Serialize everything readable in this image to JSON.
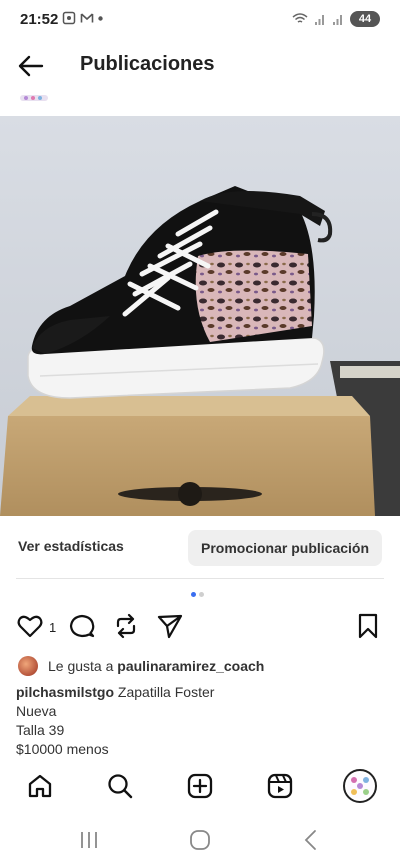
{
  "status_bar": {
    "time": "21:52",
    "battery": "44"
  },
  "header": {
    "title": "Publicaciones"
  },
  "post": {
    "stats_label": "Ver estadísticas",
    "promote_label": "Promocionar publicación",
    "like_count": "1",
    "liked_by_prefix": "Le gusta a",
    "liked_by_user": "paulinaramirez_coach",
    "username": "pilchasmilstgo",
    "caption_title": "Zapatilla Foster",
    "caption_lines": [
      "Nueva",
      "Talla 39",
      "$10000 menos"
    ]
  },
  "icons": {
    "back": "arrow-left-icon",
    "like": "heart-icon",
    "comment": "comment-icon",
    "repost": "repost-icon",
    "share": "send-icon",
    "save": "bookmark-icon",
    "home": "home-icon",
    "search": "search-icon",
    "create": "plus-square-icon",
    "reels": "reels-icon"
  },
  "colors": {
    "accent_dot": "#3a6ef0",
    "promote_bg": "#efefef"
  }
}
